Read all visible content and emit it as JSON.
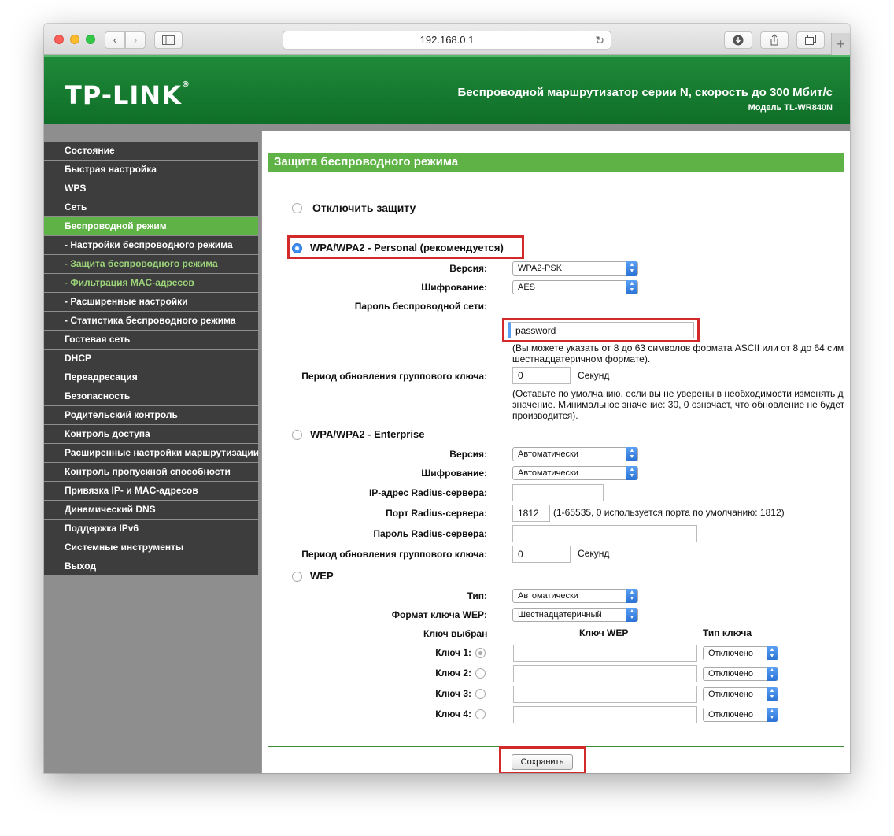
{
  "browser": {
    "url": "192.168.0.1"
  },
  "header": {
    "logo": "TP-LINK",
    "logo_mark": "®",
    "title": "Беспроводной маршрутизатор серии N, скорость до 300 Мбит/с",
    "model": "Модель TL-WR840N"
  },
  "menu": {
    "items": [
      {
        "label": "Состояние"
      },
      {
        "label": "Быстрая настройка"
      },
      {
        "label": "WPS"
      },
      {
        "label": "Сеть"
      },
      {
        "label": "Беспроводной режим"
      },
      {
        "label": "- Настройки беспроводного режима"
      },
      {
        "label": "- Защита беспроводного режима"
      },
      {
        "label": "- Фильтрация MAC-адресов"
      },
      {
        "label": "- Расширенные настройки"
      },
      {
        "label": "- Статистика беспроводного режима"
      },
      {
        "label": "Гостевая сеть"
      },
      {
        "label": "DHCP"
      },
      {
        "label": "Переадресация"
      },
      {
        "label": "Безопасность"
      },
      {
        "label": "Родительский контроль"
      },
      {
        "label": "Контроль доступа"
      },
      {
        "label": "Расширенные настройки маршрутизации"
      },
      {
        "label": "Контроль пропускной способности"
      },
      {
        "label": "Привязка IP- и MAC-адресов"
      },
      {
        "label": "Динамический DNS"
      },
      {
        "label": "Поддержка IPv6"
      },
      {
        "label": "Системные инструменты"
      },
      {
        "label": "Выход"
      }
    ]
  },
  "content": {
    "title": "Защита беспроводного режима",
    "disable": {
      "label": "Отключить защиту"
    },
    "personal": {
      "label": "WPA/WPA2 - Personal (рекомендуется)",
      "version_label": "Версия:",
      "version": "WPA2-PSK",
      "encryption_label": "Шифрование:",
      "encryption": "AES",
      "password_label": "Пароль беспроводной сети:",
      "password": "password",
      "password_note_1": "(Вы можете указать от 8 до 63 символов формата ASCII или от 8 до 64 сим",
      "password_note_2": "шестнадцатеричном формате).",
      "group_key_label": "Период обновления группового ключа:",
      "group_key": "0",
      "seconds": "Секунд",
      "group_note_1": "(Оставьте по умолчанию, если вы не уверены в необходимости изменять д",
      "group_note_2": "значение. Минимальное значение: 30, 0 означает, что обновление не будет",
      "group_note_3": "производится)."
    },
    "enterprise": {
      "label": "WPA/WPA2 - Enterprise",
      "version_label": "Версия:",
      "version": "Автоматически",
      "encryption_label": "Шифрование:",
      "encryption": "Автоматически",
      "radius_ip_label": "IP-адрес Radius-сервера:",
      "radius_ip": "",
      "radius_port_label": "Порт Radius-сервера:",
      "radius_port": "1812",
      "radius_port_note": "(1-65535, 0 используется порта по умолчанию: 1812)",
      "radius_pass_label": "Пароль Radius-сервера:",
      "radius_pass": "",
      "group_key_label": "Период обновления группового ключа:",
      "group_key": "0",
      "seconds": "Секунд"
    },
    "wep": {
      "label": "WEP",
      "type_label": "Тип:",
      "type": "Автоматически",
      "format_label": "Формат ключа WEP:",
      "format": "Шестнадцатеричный",
      "col_selected": "Ключ выбран",
      "col_key": "Ключ WEP",
      "col_type": "Тип ключа",
      "keys": [
        {
          "label": "Ключ 1:",
          "value": "",
          "type": "Отключено"
        },
        {
          "label": "Ключ 2:",
          "value": "",
          "type": "Отключено"
        },
        {
          "label": "Ключ 3:",
          "value": "",
          "type": "Отключено"
        },
        {
          "label": "Ключ 4:",
          "value": "",
          "type": "Отключено"
        }
      ]
    },
    "save_label": "Сохранить"
  },
  "colors": {
    "header_green": "#1f8a3a",
    "accent_green": "#5fb346",
    "menu_dark": "#3d3d3d",
    "highlight_red": "#d22a2a"
  }
}
